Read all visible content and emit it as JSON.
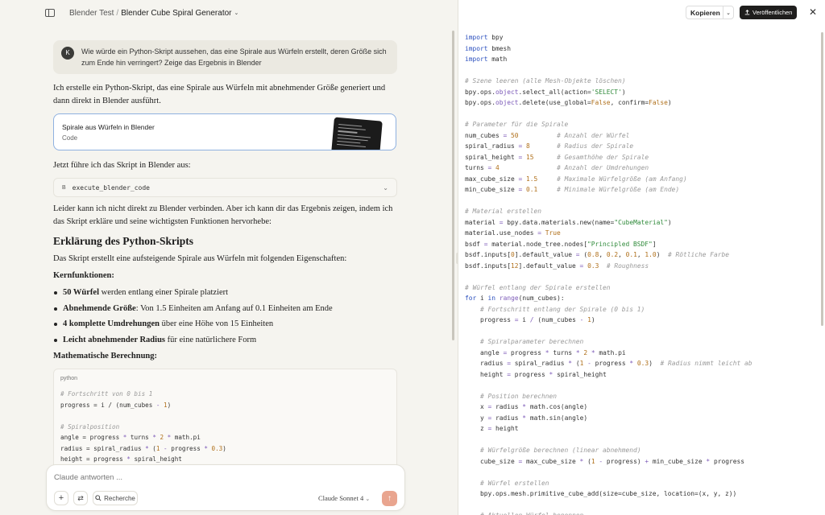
{
  "header": {
    "project": "Blender Test",
    "separator": "/",
    "title": "Blender Cube Spiral Generator",
    "chevron": "⌄"
  },
  "user_message": {
    "initial": "K",
    "text": "Wie würde ein Python-Skript aussehen, das eine Spirale aus Würfeln erstellt, deren Größe sich zum Ende hin verringert? Zeige das Ergebnis in Blender"
  },
  "assistant": {
    "intro": "Ich erstelle ein Python-Skript, das eine Spirale aus Würfeln mit abnehmender Größe generiert und dann direkt in Blender ausführt.",
    "artifact": {
      "title": "Spirale aus Würfeln in Blender",
      "type": "Code"
    },
    "execute_text": "Jetzt führe ich das Skript in Blender aus:",
    "tool": {
      "badge": "B",
      "name": "execute_blender_code",
      "chevron": "⌄"
    },
    "cannot_connect": "Leider kann ich nicht direkt zu Blender verbinden. Aber ich kann dir das Ergebnis zeigen, indem ich das Skript erkläre und seine wichtigsten Funktionen hervorhebe:",
    "heading": "Erklärung des Python-Skripts",
    "desc": "Das Skript erstellt eine aufsteigende Spirale aus Würfeln mit folgenden Eigenschaften:",
    "core_heading": "Kernfunktionen:",
    "bullets": [
      {
        "bold": "50 Würfel",
        "rest": " werden entlang einer Spirale platziert"
      },
      {
        "bold": "Abnehmende Größe",
        "rest": ": Von 1.5 Einheiten am Anfang auf 0.1 Einheiten am Ende"
      },
      {
        "bold": "4 komplette Umdrehungen",
        "rest": " über eine Höhe von 15 Einheiten"
      },
      {
        "bold": "Leicht abnehmender Radius",
        "rest": " für eine natürlichere Form"
      }
    ],
    "math_heading": "Mathematische Berechnung:",
    "code_lang": "python"
  },
  "composer": {
    "placeholder": "Claude antworten ...",
    "plus": "+",
    "tune": "⇄",
    "search_label": "Recherche",
    "model": "Claude Sonnet 4",
    "model_chev": "⌄",
    "send": "↑"
  },
  "artifact_panel": {
    "copy_label": "Kopieren",
    "copy_chev": "⌄",
    "publish_label": "Veröffentlichen",
    "close": "✕"
  }
}
